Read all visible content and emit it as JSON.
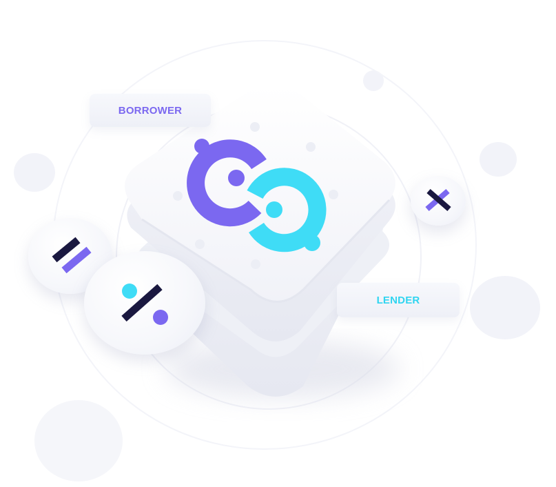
{
  "tags": {
    "borrower": "BORROWER",
    "lender": "LENDER"
  },
  "icons": {
    "logo": "linked-circles-logo-icon",
    "equals": "equals-icon",
    "percent": "percent-icon",
    "multiply": "multiply-icon"
  },
  "colors": {
    "purple": "#7b68f0",
    "cyan": "#3fdcf6",
    "navy": "#1a1840",
    "tile": "#f4f5fa",
    "background": "#ffffff"
  }
}
